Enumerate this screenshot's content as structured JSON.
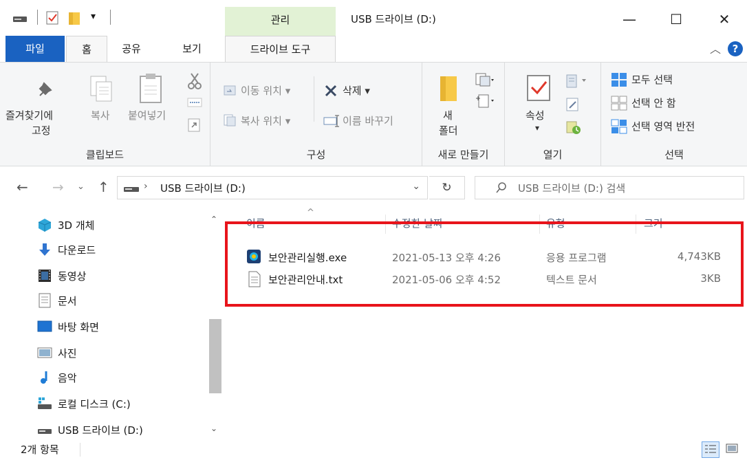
{
  "titlebar": {
    "manage_label": "관리",
    "title": "USB 드라이브 (D:)",
    "minimize": "—",
    "maximize": "☐",
    "close": "✕"
  },
  "tabs": {
    "file": "파일",
    "home": "홈",
    "share": "공유",
    "view": "보기",
    "drive_tools": "드라이브 도구",
    "help": "?"
  },
  "ribbon": {
    "clipboard": {
      "pin_label_1": "즐겨찾기에",
      "pin_label_2": "고정",
      "copy": "복사",
      "paste": "붙여넣기",
      "title": "클립보드"
    },
    "organize": {
      "move_to": "이동 위치 ▾",
      "copy_to": "복사 위치 ▾",
      "delete": "삭제 ▾",
      "rename": "이름 바꾸기",
      "title": "구성"
    },
    "new": {
      "new_folder_1": "새",
      "new_folder_2": "폴더",
      "title": "새로 만들기"
    },
    "open": {
      "properties": "속성",
      "props_arrow": "▾",
      "title": "열기"
    },
    "select": {
      "select_all": "모두 선택",
      "select_none": "선택 안 함",
      "invert": "선택 영역 반전",
      "title": "선택"
    }
  },
  "address": {
    "path": "USB 드라이브 (D:)",
    "search_placeholder": "USB 드라이브 (D:) 검색"
  },
  "nav": {
    "items": [
      {
        "label": "3D 개체",
        "icon": "cube-3d-icon"
      },
      {
        "label": "다운로드",
        "icon": "download-arrow-icon"
      },
      {
        "label": "동영상",
        "icon": "film-icon"
      },
      {
        "label": "문서",
        "icon": "document-icon"
      },
      {
        "label": "바탕 화면",
        "icon": "desktop-icon"
      },
      {
        "label": "사진",
        "icon": "picture-icon"
      },
      {
        "label": "음악",
        "icon": "music-note-icon"
      },
      {
        "label": "로컬 디스크 (C:)",
        "icon": "local-disk-icon"
      },
      {
        "label": "USB 드라이브 (D:)",
        "icon": "usb-drive-icon"
      }
    ]
  },
  "files": {
    "columns": [
      "이름",
      "수정한 날짜",
      "유형",
      "크기"
    ],
    "rows": [
      {
        "name": "보안관리실행.exe",
        "date": "2021-05-13 오후 4:26",
        "type": "응용 프로그램",
        "size": "4,743KB",
        "icon": "exe-app-icon"
      },
      {
        "name": "보안관리안내.txt",
        "date": "2021-05-06 오후 4:52",
        "type": "텍스트 문서",
        "size": "3KB",
        "icon": "text-file-icon"
      }
    ]
  },
  "status": {
    "count": "2개 항목"
  },
  "colors": {
    "accent": "#1a62c1",
    "manage_tab": "#e2f2d5",
    "highlight": "#e8141b"
  }
}
